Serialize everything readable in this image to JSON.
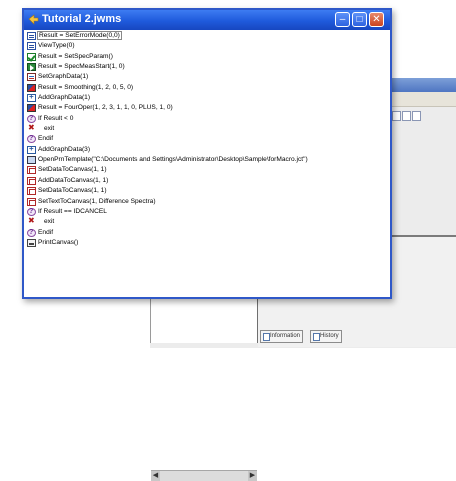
{
  "macro_window": {
    "title": "Tutorial 2.jwms",
    "lines": [
      {
        "text": "Result = SetErrorMode(0,0)",
        "icon": "error-mode-icon",
        "cls": "ic-doc"
      },
      {
        "text": "ViewType(0)",
        "icon": "view-type-icon",
        "cls": "ic-doc"
      },
      {
        "text": "Result = SetSpecParam()",
        "icon": "spec-param-icon",
        "cls": "ic-check"
      },
      {
        "text": "Result = SpecMeasStart(1, 0)",
        "icon": "measure-start-icon",
        "cls": "ic-green"
      },
      {
        "text": "SetGraphData(1)",
        "icon": "graph-data-icon",
        "cls": "ic-graph"
      },
      {
        "text": "Result = Smoothing(1, 2, 0, 5, 0)",
        "icon": "smoothing-icon",
        "cls": "ic-smooth"
      },
      {
        "text": "AddGraphData(1)",
        "icon": "add-graph-icon",
        "cls": "ic-add"
      },
      {
        "text": "Result = FourOper(1, 2, 3, 1, 1, 0, PLUS, 1, 0)",
        "icon": "four-oper-icon",
        "cls": "ic-smooth"
      },
      {
        "text": "If Result < 0",
        "icon": "if-icon",
        "cls": "ic-if"
      },
      {
        "text": "exit",
        "icon": "exit-icon",
        "cls": "ic-exit"
      },
      {
        "text": "Endif",
        "icon": "endif-icon",
        "cls": "ic-if"
      },
      {
        "text": "AddGraphData(3)",
        "icon": "add-graph-icon",
        "cls": "ic-add"
      },
      {
        "text": "OpenPrnTemplate(\"C:\\Documents and Settings\\Administrator\\Desktop\\Sample\\forMacro.jct\")",
        "icon": "template-icon",
        "cls": "ic-template"
      },
      {
        "text": "SetDataToCanvas(1, 1)",
        "icon": "canvas-icon",
        "cls": "ic-canvas"
      },
      {
        "text": "AddDataToCanvas(1, 1)",
        "icon": "canvas-icon",
        "cls": "ic-canvas"
      },
      {
        "text": "SetDataToCanvas(1, 1)",
        "icon": "canvas-icon",
        "cls": "ic-canvas"
      },
      {
        "text": "SetTextToCanvas(1, Difference Spectra)",
        "icon": "text-canvas-icon",
        "cls": "ic-canvas"
      },
      {
        "text": "If Result == IDCANCEL",
        "icon": "if-icon",
        "cls": "ic-if"
      },
      {
        "text": "exit",
        "icon": "exit-icon",
        "cls": "ic-exit"
      },
      {
        "text": "Endif",
        "icon": "endif-icon",
        "cls": "ic-if"
      },
      {
        "text": "PrintCanvas()",
        "icon": "print-icon",
        "cls": "ic-print"
      }
    ]
  },
  "background_window": {
    "tabs": [
      {
        "label": "Information"
      },
      {
        "label": "History"
      }
    ]
  },
  "colors": {
    "titlebar": "#1f5adc",
    "close_button": "#c9431e"
  }
}
